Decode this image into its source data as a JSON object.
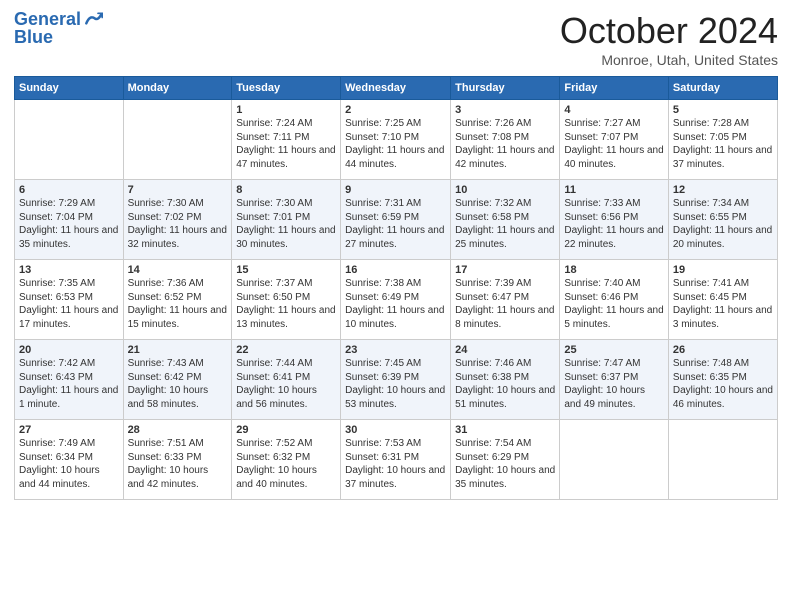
{
  "header": {
    "logo_line1": "General",
    "logo_line2": "Blue",
    "month_title": "October 2024",
    "location": "Monroe, Utah, United States"
  },
  "days_of_week": [
    "Sunday",
    "Monday",
    "Tuesday",
    "Wednesday",
    "Thursday",
    "Friday",
    "Saturday"
  ],
  "weeks": [
    [
      {
        "day": "",
        "info": ""
      },
      {
        "day": "",
        "info": ""
      },
      {
        "day": "1",
        "info": "Sunrise: 7:24 AM\nSunset: 7:11 PM\nDaylight: 11 hours\nand 47 minutes."
      },
      {
        "day": "2",
        "info": "Sunrise: 7:25 AM\nSunset: 7:10 PM\nDaylight: 11 hours\nand 44 minutes."
      },
      {
        "day": "3",
        "info": "Sunrise: 7:26 AM\nSunset: 7:08 PM\nDaylight: 11 hours\nand 42 minutes."
      },
      {
        "day": "4",
        "info": "Sunrise: 7:27 AM\nSunset: 7:07 PM\nDaylight: 11 hours\nand 40 minutes."
      },
      {
        "day": "5",
        "info": "Sunrise: 7:28 AM\nSunset: 7:05 PM\nDaylight: 11 hours\nand 37 minutes."
      }
    ],
    [
      {
        "day": "6",
        "info": "Sunrise: 7:29 AM\nSunset: 7:04 PM\nDaylight: 11 hours\nand 35 minutes."
      },
      {
        "day": "7",
        "info": "Sunrise: 7:30 AM\nSunset: 7:02 PM\nDaylight: 11 hours\nand 32 minutes."
      },
      {
        "day": "8",
        "info": "Sunrise: 7:30 AM\nSunset: 7:01 PM\nDaylight: 11 hours\nand 30 minutes."
      },
      {
        "day": "9",
        "info": "Sunrise: 7:31 AM\nSunset: 6:59 PM\nDaylight: 11 hours\nand 27 minutes."
      },
      {
        "day": "10",
        "info": "Sunrise: 7:32 AM\nSunset: 6:58 PM\nDaylight: 11 hours\nand 25 minutes."
      },
      {
        "day": "11",
        "info": "Sunrise: 7:33 AM\nSunset: 6:56 PM\nDaylight: 11 hours\nand 22 minutes."
      },
      {
        "day": "12",
        "info": "Sunrise: 7:34 AM\nSunset: 6:55 PM\nDaylight: 11 hours\nand 20 minutes."
      }
    ],
    [
      {
        "day": "13",
        "info": "Sunrise: 7:35 AM\nSunset: 6:53 PM\nDaylight: 11 hours\nand 17 minutes."
      },
      {
        "day": "14",
        "info": "Sunrise: 7:36 AM\nSunset: 6:52 PM\nDaylight: 11 hours\nand 15 minutes."
      },
      {
        "day": "15",
        "info": "Sunrise: 7:37 AM\nSunset: 6:50 PM\nDaylight: 11 hours\nand 13 minutes."
      },
      {
        "day": "16",
        "info": "Sunrise: 7:38 AM\nSunset: 6:49 PM\nDaylight: 11 hours\nand 10 minutes."
      },
      {
        "day": "17",
        "info": "Sunrise: 7:39 AM\nSunset: 6:47 PM\nDaylight: 11 hours\nand 8 minutes."
      },
      {
        "day": "18",
        "info": "Sunrise: 7:40 AM\nSunset: 6:46 PM\nDaylight: 11 hours\nand 5 minutes."
      },
      {
        "day": "19",
        "info": "Sunrise: 7:41 AM\nSunset: 6:45 PM\nDaylight: 11 hours\nand 3 minutes."
      }
    ],
    [
      {
        "day": "20",
        "info": "Sunrise: 7:42 AM\nSunset: 6:43 PM\nDaylight: 11 hours\nand 1 minute."
      },
      {
        "day": "21",
        "info": "Sunrise: 7:43 AM\nSunset: 6:42 PM\nDaylight: 10 hours\nand 58 minutes."
      },
      {
        "day": "22",
        "info": "Sunrise: 7:44 AM\nSunset: 6:41 PM\nDaylight: 10 hours\nand 56 minutes."
      },
      {
        "day": "23",
        "info": "Sunrise: 7:45 AM\nSunset: 6:39 PM\nDaylight: 10 hours\nand 53 minutes."
      },
      {
        "day": "24",
        "info": "Sunrise: 7:46 AM\nSunset: 6:38 PM\nDaylight: 10 hours\nand 51 minutes."
      },
      {
        "day": "25",
        "info": "Sunrise: 7:47 AM\nSunset: 6:37 PM\nDaylight: 10 hours\nand 49 minutes."
      },
      {
        "day": "26",
        "info": "Sunrise: 7:48 AM\nSunset: 6:35 PM\nDaylight: 10 hours\nand 46 minutes."
      }
    ],
    [
      {
        "day": "27",
        "info": "Sunrise: 7:49 AM\nSunset: 6:34 PM\nDaylight: 10 hours\nand 44 minutes."
      },
      {
        "day": "28",
        "info": "Sunrise: 7:51 AM\nSunset: 6:33 PM\nDaylight: 10 hours\nand 42 minutes."
      },
      {
        "day": "29",
        "info": "Sunrise: 7:52 AM\nSunset: 6:32 PM\nDaylight: 10 hours\nand 40 minutes."
      },
      {
        "day": "30",
        "info": "Sunrise: 7:53 AM\nSunset: 6:31 PM\nDaylight: 10 hours\nand 37 minutes."
      },
      {
        "day": "31",
        "info": "Sunrise: 7:54 AM\nSunset: 6:29 PM\nDaylight: 10 hours\nand 35 minutes."
      },
      {
        "day": "",
        "info": ""
      },
      {
        "day": "",
        "info": ""
      }
    ]
  ]
}
